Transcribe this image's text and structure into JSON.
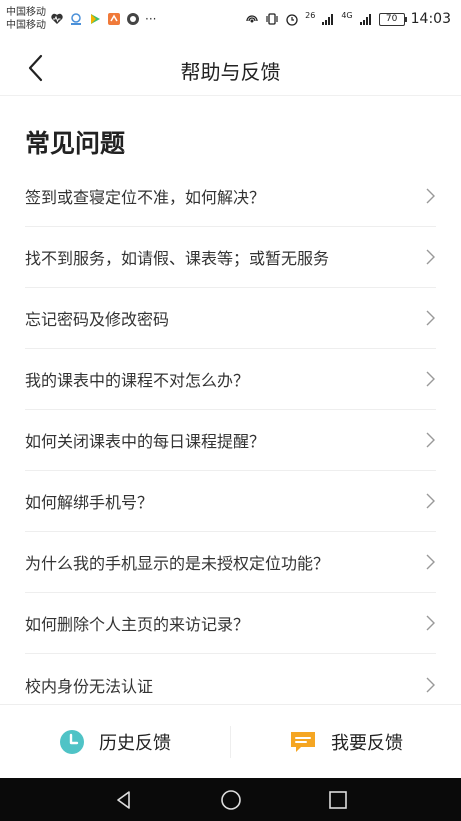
{
  "status_bar": {
    "carrier_line1": "中国移动",
    "carrier_line2": "中国移动",
    "network_1": "26",
    "network_2": "4G",
    "battery": "70",
    "time": "14:03",
    "more": "···"
  },
  "header": {
    "title": "帮助与反馈"
  },
  "faq": {
    "section_title": "常见问题",
    "items": [
      "签到或查寝定位不准，如何解决？",
      "找不到服务，如请假、课表等；或暂无服务",
      "忘记密码及修改密码",
      "我的课表中的课程不对怎么办？",
      "如何关闭课表中的每日课程提醒？",
      "如何解绑手机号？",
      "为什么我的手机显示的是未授权定位功能？",
      "如何删除个人主页的来访记录？",
      "校内身份无法认证"
    ]
  },
  "bottom_bar": {
    "history_label": "历史反馈",
    "feedback_label": "我要反馈"
  },
  "colors": {
    "history_icon": "#4fc3c6",
    "feedback_icon": "#f5a623",
    "nav_bar": "#0a0a0a"
  }
}
